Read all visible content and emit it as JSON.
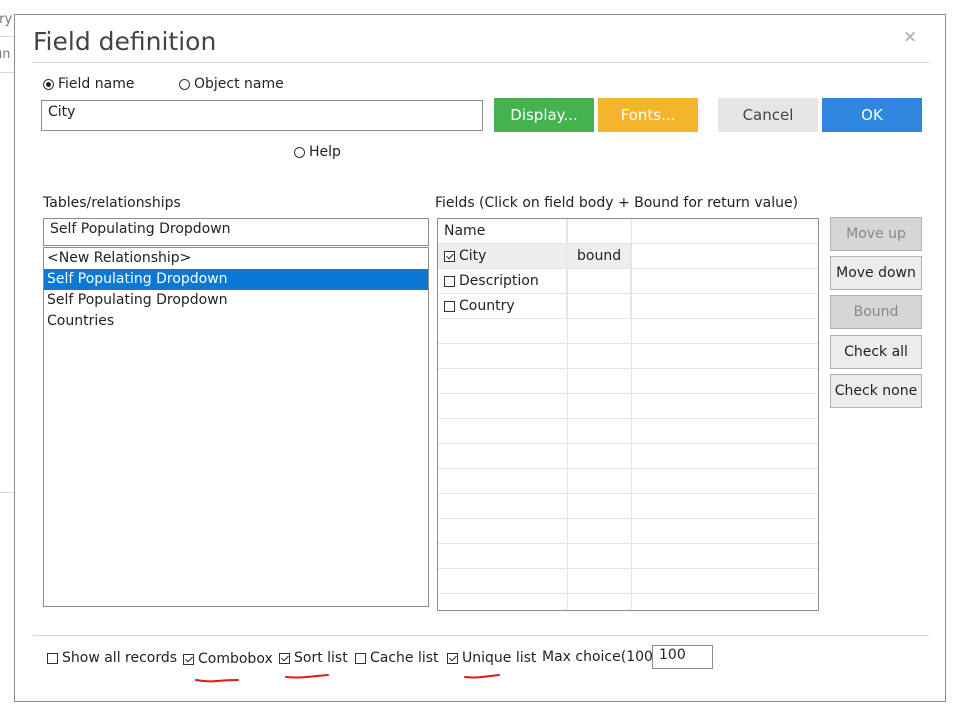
{
  "background": {
    "fragments": [
      "try",
      "un"
    ]
  },
  "dialog": {
    "title": "Field definition",
    "close_symbol": "×"
  },
  "name_mode": {
    "field_name_label": "Field name",
    "object_name_label": "Object name",
    "selected": "field"
  },
  "field_input": {
    "value": "City"
  },
  "buttons": {
    "display": "Display...",
    "fonts": "Fonts...",
    "cancel": "Cancel",
    "ok": "OK"
  },
  "help": {
    "label": "Help"
  },
  "tables": {
    "label": "Tables/relationships",
    "current_value": "Self Populating Dropdown",
    "items": [
      "<New Relationship>",
      "Self Populating Dropdown",
      "Self Populating Dropdown",
      "Countries"
    ],
    "selected_index": 1
  },
  "fields": {
    "label": "Fields (Click on field body + Bound for return value)",
    "header_name": "Name",
    "rows": [
      {
        "name": "City",
        "checked": true,
        "bound": "bound"
      },
      {
        "name": "Description",
        "checked": false,
        "bound": ""
      },
      {
        "name": "Country",
        "checked": false,
        "bound": ""
      }
    ]
  },
  "side_buttons": {
    "move_up": "Move up",
    "move_down": "Move down",
    "bound": "Bound",
    "check_all": "Check all",
    "check_none": "Check none"
  },
  "options": {
    "show_all_records": {
      "label": "Show all records",
      "checked": false
    },
    "combobox": {
      "label": "Combobox",
      "checked": true
    },
    "sort_list": {
      "label": "Sort list",
      "checked": true
    },
    "cache_list": {
      "label": "Cache list",
      "checked": false
    },
    "unique_list": {
      "label": "Unique list",
      "checked": true
    },
    "max_choice_label": "Max choice(100)",
    "max_choice_value": "100"
  },
  "colors": {
    "display_btn": "#44b34d",
    "fonts_btn": "#f4b52c",
    "ok_btn": "#2f86de",
    "selection": "#0a78d4",
    "annotation": "#e0191b"
  }
}
